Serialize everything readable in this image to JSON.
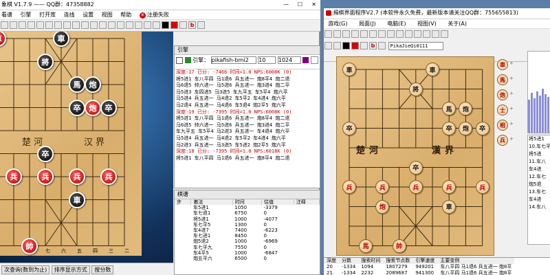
{
  "left_window": {
    "title": "象棋 V1.7.9 —— QQ群：47358882",
    "menu": [
      "看谱",
      "引擎",
      "打开库",
      "连线",
      "设置",
      "视图",
      "帮助"
    ],
    "register": "注册失败",
    "board": {
      "river_left": "楚河",
      "river_right": "汉界",
      "bottom_files": [
        "八",
        "七",
        "六",
        "五",
        "四",
        "三",
        "二"
      ],
      "pieces": [
        {
          "label": "車",
          "side": "red",
          "col": 0,
          "row": 0
        },
        {
          "label": "車",
          "side": "black",
          "col": 4,
          "row": 0
        },
        {
          "label": "將",
          "side": "black",
          "col": 3,
          "row": 1
        },
        {
          "label": "馬",
          "side": "black",
          "col": 5,
          "row": 2
        },
        {
          "label": "炮",
          "side": "black",
          "col": 6,
          "row": 2
        },
        {
          "label": "卒",
          "side": "black",
          "col": 5,
          "row": 3
        },
        {
          "label": "炮",
          "side": "red",
          "col": 6,
          "row": 3
        },
        {
          "label": "卒",
          "side": "black",
          "col": 7,
          "row": 3
        },
        {
          "label": "卒",
          "side": "black",
          "col": 3,
          "row": 5
        },
        {
          "label": "兵",
          "side": "red",
          "col": -1,
          "row": 6
        },
        {
          "label": "兵",
          "side": "red",
          "col": 1,
          "row": 6
        },
        {
          "label": "兵",
          "side": "red",
          "col": 3,
          "row": 6
        },
        {
          "label": "兵",
          "side": "red",
          "col": 5,
          "row": 6
        },
        {
          "label": "兵",
          "side": "red",
          "col": 7,
          "row": 6
        },
        {
          "label": "馬",
          "side": "black",
          "col": -1,
          "row": 7
        },
        {
          "label": "車",
          "side": "black",
          "col": 5,
          "row": 7
        },
        {
          "label": "馬",
          "side": "red",
          "col": -1,
          "row": 9
        },
        {
          "label": "帥",
          "side": "red",
          "col": 2,
          "row": 9
        }
      ]
    },
    "status": {
      "option1": "次查询(数到为止)",
      "option2": "排序显示方式",
      "option3": "按分数"
    }
  },
  "engine_panel": {
    "title": "引擎",
    "label": "引擎：",
    "engine_name": "pikafish-bmi2",
    "depth": "10",
    "hash": "1024",
    "lines": [
      {
        "hdr": true,
        "text": "深度:17  已分: -7466  时间=1.0  NPS:6008K  (0)"
      },
      {
        "text": "将5进1 车八平四 马1退6 兵五进一 炮8平4 炮二退"
      },
      {
        "text": "马6退5 帅六进一 马5进6 兵五进一 炮3进4 炮二平"
      },
      {
        "text": "马5进3 车四进5 马3进5 车九平五 车5平4 炮六平"
      },
      {
        "text": "马5进4 兵五进一 马4退2 车5平2 车4进4 炮六平"
      },
      {
        "text": "马2退4 兵五进一 马4退6 车5退4 炮2平5 炮六平"
      },
      {
        "hdr": true,
        "text": "深度:19  已分: -7395  时间=1.0  NPS:6008K  (0)"
      },
      {
        "text": "将5进1 车八平四 马1退6 兵五进一 炮8平4 炮二退"
      },
      {
        "text": "马6进5 帅六进一 马5进6 兵五进一 炮3进4 炮二平"
      },
      {
        "text": "车九平五 车5平4 马2进3 兵五进一 车4退4 炮六平"
      },
      {
        "text": "马5进4 兵五进一 马4退2 车5平2 车4进4 炮六平"
      },
      {
        "text": "马2进3 兵五进一 马3进5 车5进2 炮2平5 炮六平"
      },
      {
        "hdr": true,
        "text": "深度:18  已分: -7395  时间=1.0  NPS:6018K  (0)"
      },
      {
        "text": "将5进1 车八平四 马1退6 兵五进一 炮8平4 炮二退"
      }
    ]
  },
  "moves_panel": {
    "title": "棋谱",
    "headers": [
      "步",
      "着法",
      "时间",
      "估值",
      "注释"
    ],
    "rows": [
      [
        "",
        "车5进1",
        "1050",
        "-3379",
        ""
      ],
      [
        "",
        "车七退1",
        "6750",
        "0",
        ""
      ],
      [
        "",
        "将5进1",
        "1000",
        "-4077",
        ""
      ],
      [
        "",
        "车七平5",
        "1300",
        "0",
        ""
      ],
      [
        "",
        "车4进7",
        "7400",
        "-6223",
        ""
      ],
      [
        "",
        "车七进1",
        "8450",
        "0",
        ""
      ],
      [
        "",
        "炮5退2",
        "1000",
        "-6969",
        ""
      ],
      [
        "",
        "车七平九",
        "7550",
        "0",
        ""
      ],
      [
        "",
        "车4平5",
        "1000",
        "-6847",
        ""
      ],
      [
        "",
        "炮五平六",
        "6500",
        "0",
        ""
      ]
    ]
  },
  "right_window": {
    "title": "揭棋界面程序V2.7  (本软件永久免费，最新版本请关注QQ群：755655813)",
    "menu": [
      "游戏(G)",
      "局面(J)",
      "电脑(E)",
      "视图(V)",
      "关于(A)"
    ],
    "engine_field": "PikaJieQi0111",
    "board": {
      "river_left": "楚河",
      "river_right": "漢界",
      "pieces": [
        {
          "label": "車",
          "side": "black",
          "col": 0,
          "row": 0
        },
        {
          "label": "車",
          "side": "black",
          "col": 5,
          "row": 0
        },
        {
          "label": "將",
          "side": "black",
          "col": 4,
          "row": 1
        },
        {
          "label": "馬",
          "side": "black",
          "col": 6,
          "row": 2
        },
        {
          "label": "炮",
          "side": "black",
          "col": 7,
          "row": 2
        },
        {
          "label": "卒",
          "side": "black",
          "col": 0,
          "row": 3
        },
        {
          "label": "卒",
          "side": "black",
          "col": 6,
          "row": 3
        },
        {
          "label": "炮",
          "side": "black",
          "col": 7,
          "row": 3
        },
        {
          "label": "卒",
          "side": "black",
          "col": 8,
          "row": 3
        },
        {
          "label": "卒",
          "side": "black",
          "col": 4,
          "row": 5
        },
        {
          "label": "兵",
          "side": "red",
          "col": 0,
          "row": 6
        },
        {
          "label": "兵",
          "side": "red",
          "col": 2,
          "row": 6
        },
        {
          "label": "兵",
          "side": "red",
          "col": 4,
          "row": 6
        },
        {
          "label": "兵",
          "side": "red",
          "col": 6,
          "row": 6
        },
        {
          "label": "兵",
          "side": "red",
          "col": 8,
          "row": 6
        },
        {
          "label": "炮",
          "side": "red",
          "col": 2,
          "row": 7
        },
        {
          "label": "車",
          "side": "black",
          "col": 6,
          "row": 7
        },
        {
          "label": "馬",
          "side": "red",
          "col": 1,
          "row": 9
        },
        {
          "label": "帥",
          "side": "red",
          "col": 3,
          "row": 9
        }
      ]
    },
    "reserve": [
      {
        "label": "車",
        "side": "red"
      },
      {
        "label": "馬",
        "side": "red"
      },
      {
        "label": "炮",
        "side": "red"
      },
      {
        "label": "士",
        "side": "red"
      },
      {
        "label": "相",
        "side": "red"
      },
      {
        "label": "兵",
        "side": "red"
      }
    ],
    "side_moves": [
      "将5进1",
      "10.车七平",
      "将5进",
      "11.车八",
      "车4进",
      "12.车七",
      "炮5退",
      "13.车七",
      "车4进",
      "14.车八"
    ],
    "search_table": {
      "headers": [
        "深度",
        "分数",
        "搜索时间",
        "搜索节点数",
        "引擎速度",
        "主要变例"
      ],
      "rows": [
        [
          "20",
          "-1334",
          "1094",
          "1807279",
          "949201",
          "车八平四 马1退6 兵五进一 炮8平"
        ],
        [
          "21",
          "-1334",
          "2232",
          "2089687",
          "941300",
          "车八平四 马1退6 兵五进一 炮8平"
        ],
        [
          "22",
          "-1334",
          "3125",
          "3080476",
          "969280",
          "车八平四 马1退6 兵五进一 炮8平"
        ]
      ]
    }
  },
  "colors": {
    "red": "#c00000",
    "black": "#1a1a1a",
    "accent": "#3a78d8"
  }
}
